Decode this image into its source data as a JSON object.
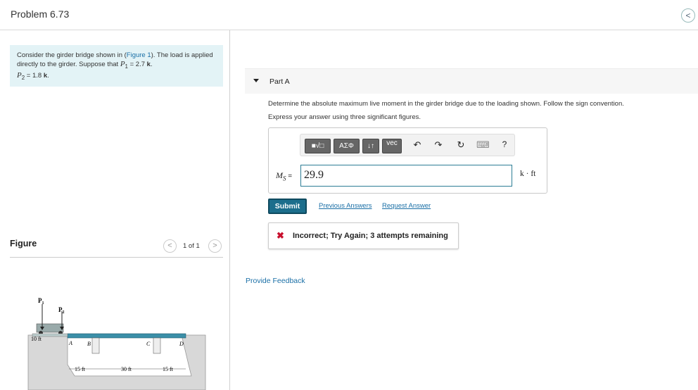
{
  "header": {
    "title": "Problem 6.73",
    "nav_glyph": "<"
  },
  "intro": {
    "text1": "Consider the girder bridge shown in (",
    "figure_link": "Figure 1",
    "text2": "). The load is applied directly to the girder. Suppose that ",
    "p1": "P",
    "p1_sub": "1",
    "p1_val": " = 2.7 ",
    "unit": "k",
    "sep": ".",
    "p2": "P",
    "p2_sub": "2",
    "p2_val": " = 1.8 ",
    "end": "."
  },
  "figure_panel": {
    "label": "Figure",
    "pager": "1 of 1",
    "prev": "<",
    "next": ">"
  },
  "figure": {
    "load1": "P",
    "load1_sub": "1",
    "load2": "P",
    "load2_sub": "2",
    "dim_left": "10 ft",
    "dim1": "15 ft",
    "dim2": "30 ft",
    "dim3": "15 ft",
    "point_a": "A",
    "point_b": "B",
    "point_c": "C",
    "point_d": "D"
  },
  "part": {
    "label": "Part A"
  },
  "question": "Determine the absolute maximum live moment in the girder bridge due to the loading shown. Follow the sign convention.",
  "express": "Express your answer using three significant figures.",
  "toolbar": {
    "templates": "■√□",
    "greek": "ΑΣΦ",
    "arrows": "↓↑",
    "vec": "vec",
    "undo": "↶",
    "redo": "↷",
    "reset": "↻",
    "keyboard": "⌨",
    "help": "?"
  },
  "answer": {
    "label_var": "M",
    "label_sub": "S",
    "label_eq": " =",
    "value": "29.9",
    "units": "k · ft"
  },
  "actions": {
    "submit": "Submit",
    "previous": "Previous Answers",
    "request": "Request Answer"
  },
  "result": {
    "icon": "✖",
    "message": "Incorrect; Try Again; 3 attempts remaining"
  },
  "provide_feedback": "Provide Feedback"
}
